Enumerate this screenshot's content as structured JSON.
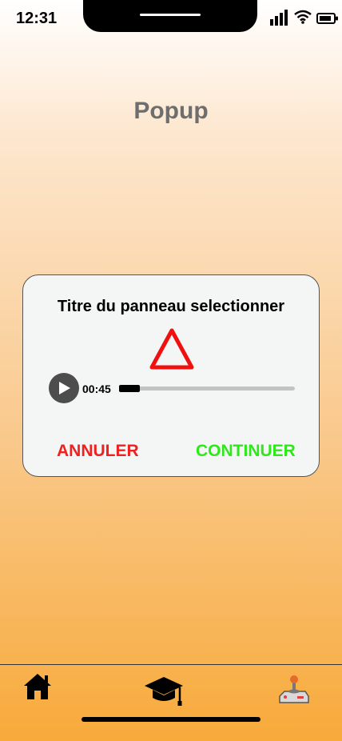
{
  "status_bar": {
    "time": "12:31"
  },
  "page": {
    "title": "Popup"
  },
  "popup": {
    "title": "Titre du panneau selectionner",
    "audio": {
      "time": "00:45",
      "progress": 0.12
    },
    "cancel_label": "ANNULER",
    "continue_label": "CONTINUER"
  },
  "colors": {
    "cancel": "#f02020",
    "continue": "#2ee81a",
    "warning": "#f01010"
  },
  "nav": {
    "items": [
      {
        "icon": "home-icon"
      },
      {
        "icon": "graduation-cap-icon"
      },
      {
        "icon": "joystick-icon"
      }
    ]
  }
}
